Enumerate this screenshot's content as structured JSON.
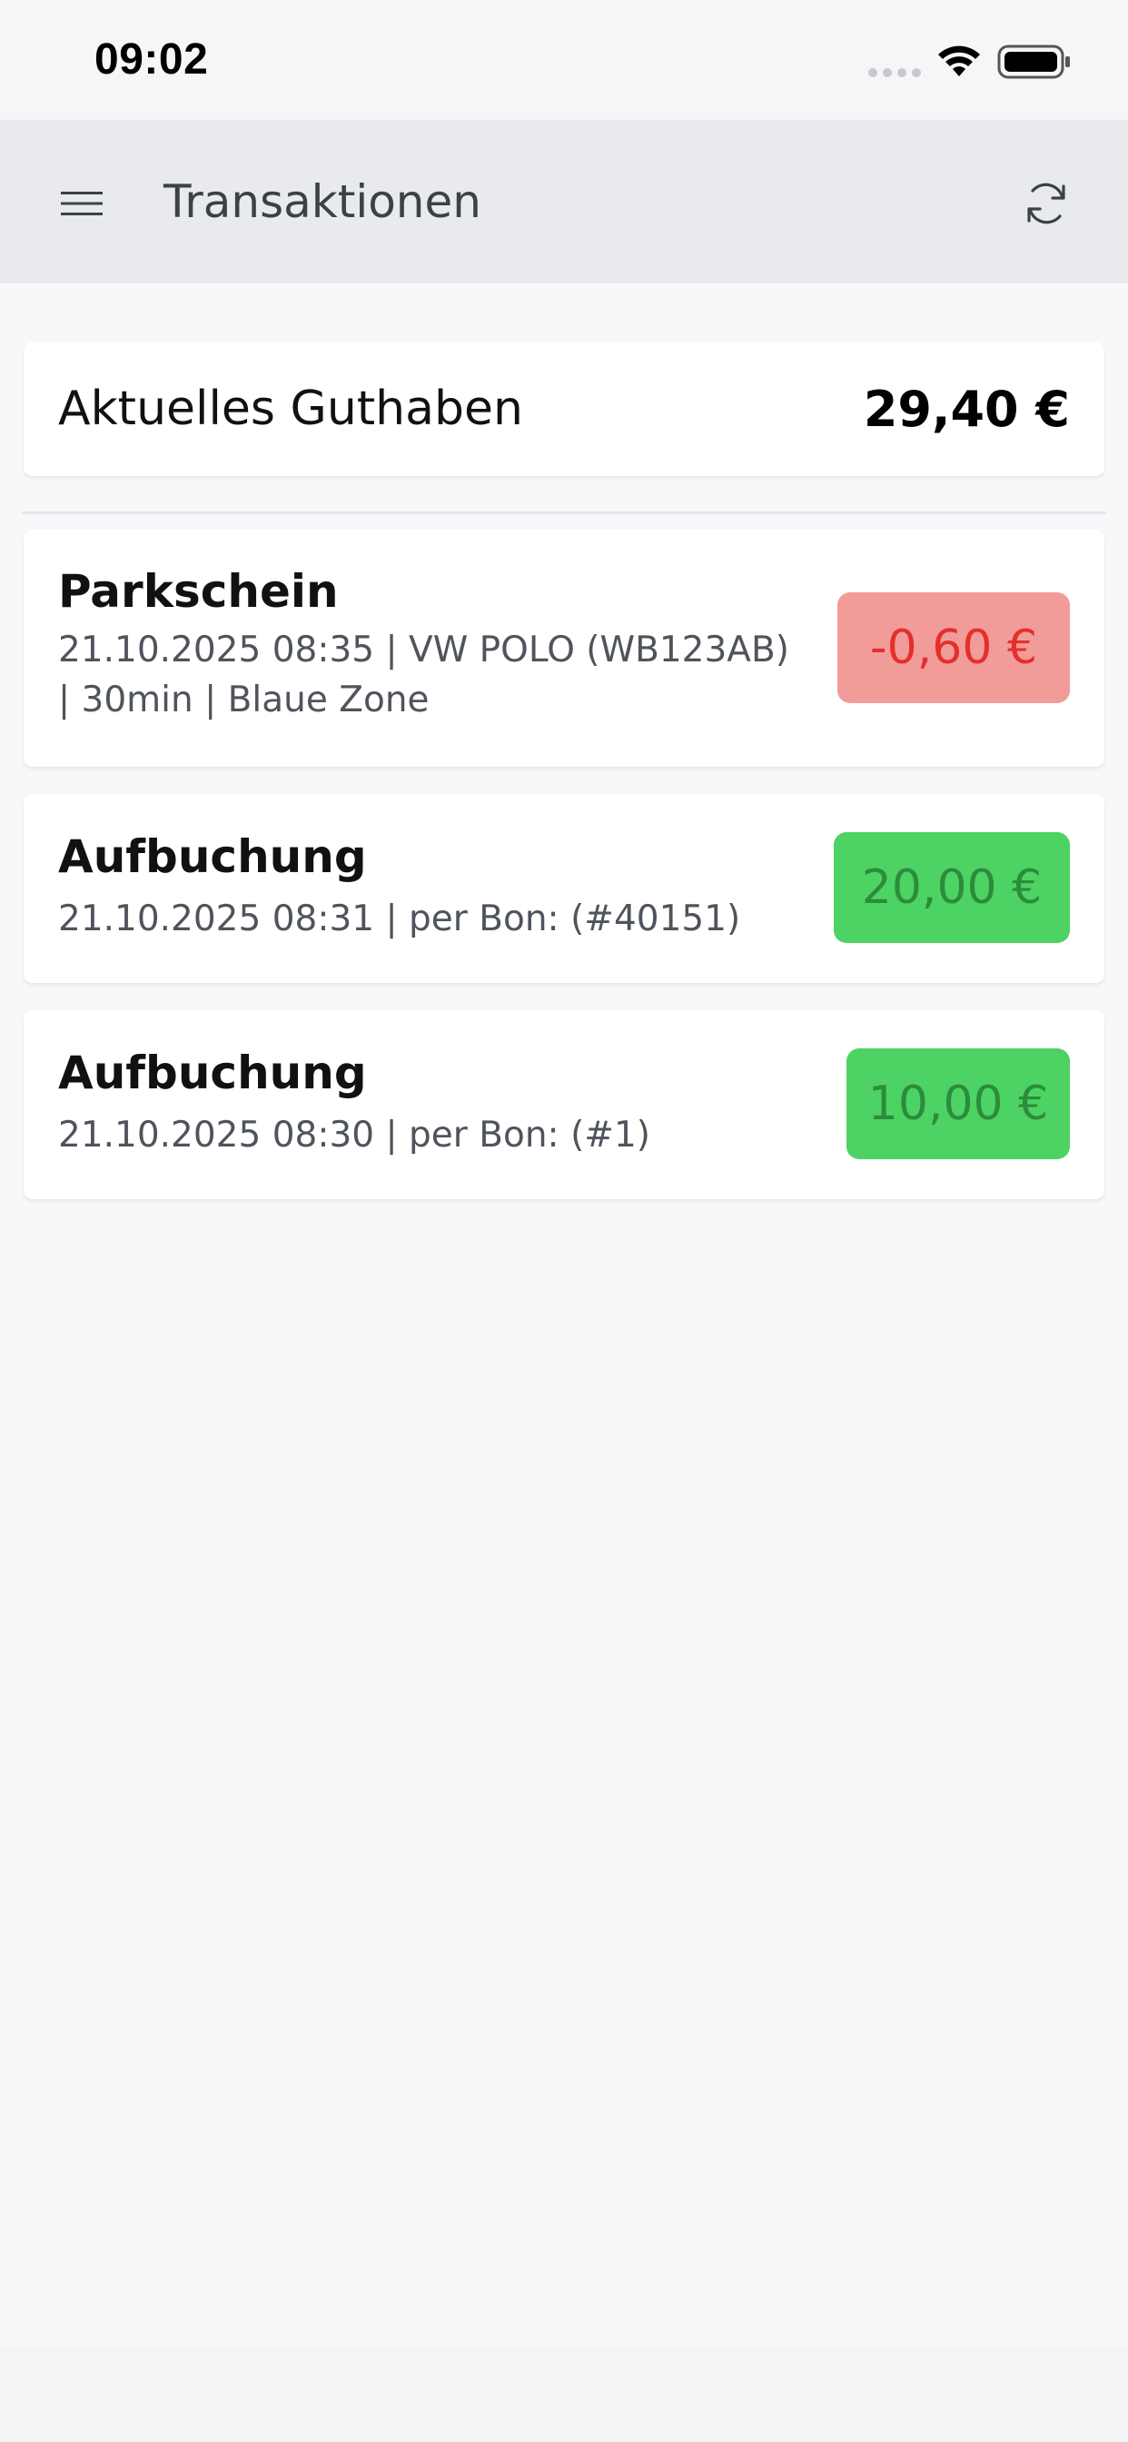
{
  "status_bar": {
    "time": "09:02"
  },
  "app_bar": {
    "title": "Transaktionen",
    "menu_icon": "hamburger-menu-icon",
    "refresh_icon": "refresh-icon"
  },
  "balance": {
    "label": "Aktuelles Guthaben",
    "value": "29,40 €"
  },
  "transactions": [
    {
      "title": "Parkschein",
      "detail": "21.10.2025 08:35 | VW POLO (WB123AB) | 30min | Blaue Zone",
      "amount": "-0,60 €",
      "type": "debit"
    },
    {
      "title": "Aufbuchung",
      "detail": "21.10.2025 08:31 | per Bon: (#40151)",
      "amount": "20,00 €",
      "type": "credit"
    },
    {
      "title": "Aufbuchung",
      "detail": "21.10.2025 08:30 | per Bon: (#1)",
      "amount": "10,00 €",
      "type": "credit"
    }
  ],
  "colors": {
    "debit_bg": "#f29c9a",
    "debit_text": "#e4302d",
    "credit_bg": "#4cd363",
    "credit_text": "#2c8c3c",
    "app_bar_bg": "#e8eaed"
  }
}
